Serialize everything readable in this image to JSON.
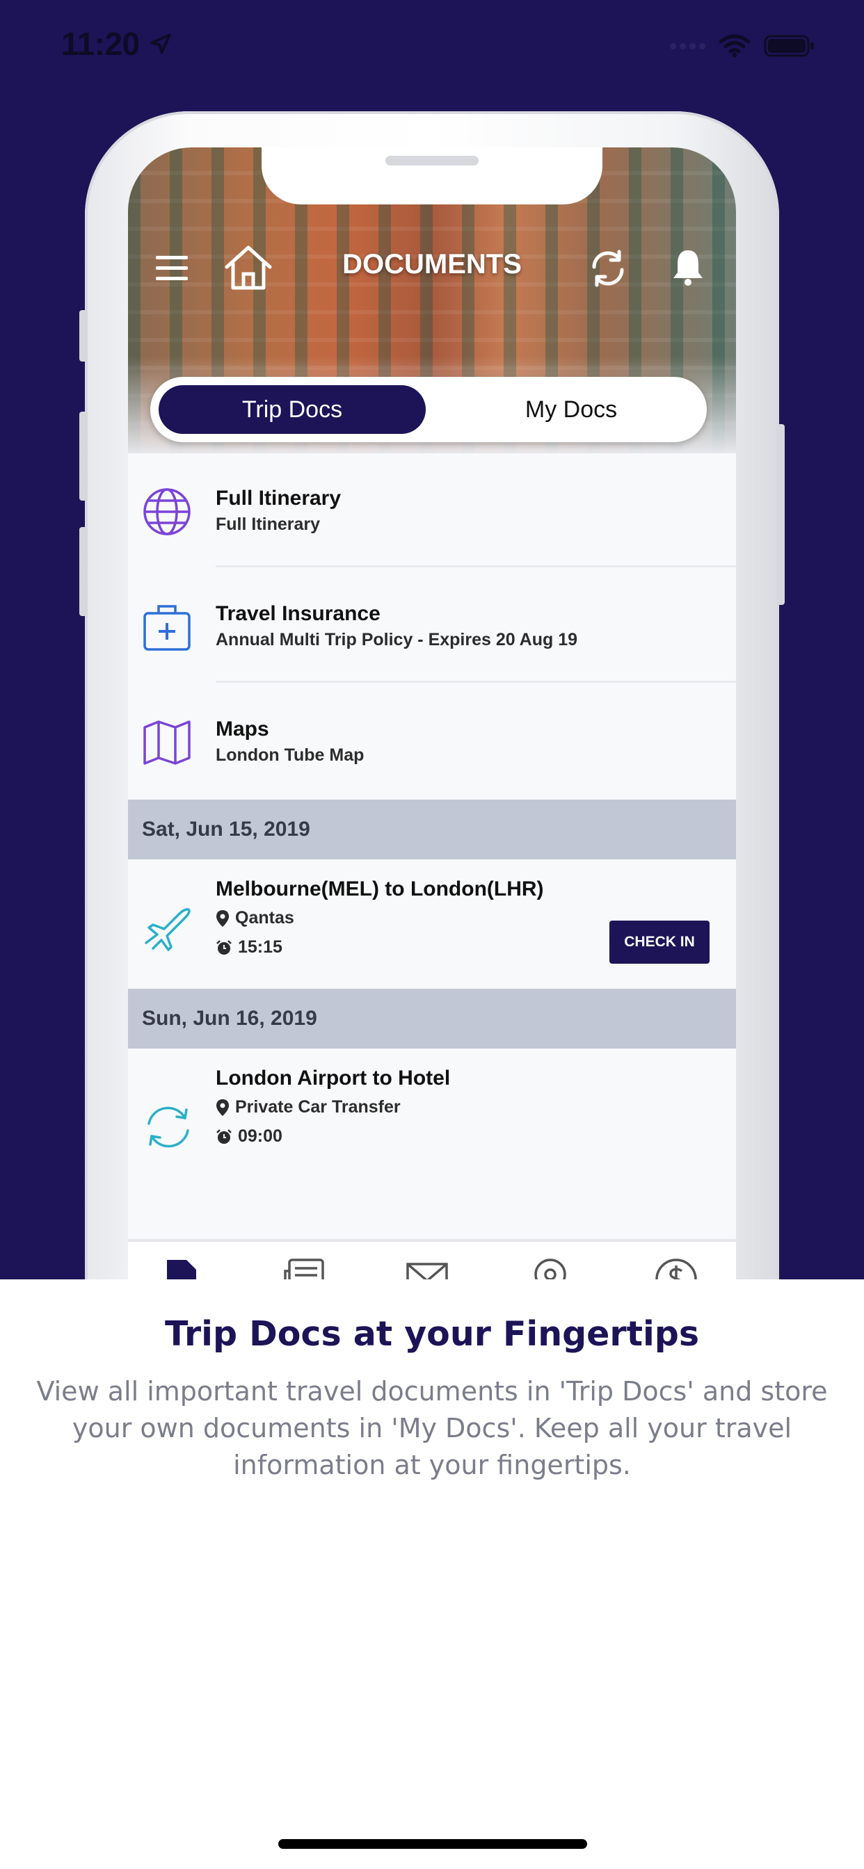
{
  "status_bar": {
    "time": "11:20"
  },
  "header": {
    "title": "DOCUMENTS"
  },
  "segment": {
    "active": "Trip Docs",
    "other": "My Docs"
  },
  "documents": [
    {
      "title": "Full Itinerary",
      "subtitle": "Full Itinerary",
      "icon": "globe-icon"
    },
    {
      "title": "Travel Insurance",
      "subtitle": "Annual Multi Trip Policy - Expires 20 Aug 19",
      "icon": "medical-bag-icon"
    },
    {
      "title": "Maps",
      "subtitle": "London Tube Map",
      "icon": "map-icon"
    }
  ],
  "schedule": [
    {
      "date": "Sat, Jun 15, 2019",
      "title": "Melbourne(MEL) to London(LHR)",
      "provider": "Qantas",
      "time": "15:15",
      "icon": "plane-icon",
      "action": "CHECK IN"
    },
    {
      "date": "Sun, Jun 16, 2019",
      "title": "London Airport to Hotel",
      "provider": "Private Car Transfer",
      "time": "09:00",
      "icon": "transfer-icon"
    }
  ],
  "caption": {
    "title": "Trip Docs at your Fingertips",
    "body": "View all important travel documents in 'Trip Docs' and store your own documents in 'My Docs'. Keep all your travel information at your fingertips."
  },
  "colors": {
    "brand": "#1c1457",
    "date_band": "#c2c7d5",
    "icon_purple": "#7a45d6",
    "icon_blue": "#2f6fd8",
    "icon_teal": "#2bb0c8"
  }
}
